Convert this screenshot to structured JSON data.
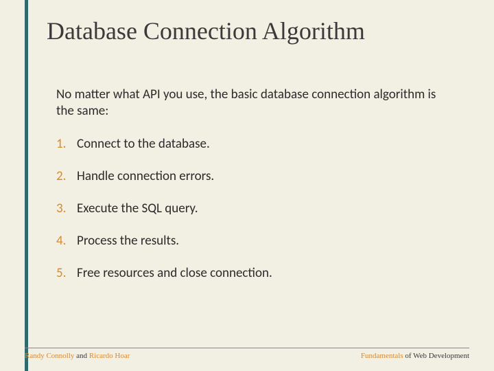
{
  "title": "Database Connection Algorithm",
  "intro": "No matter what API you use, the basic database connection algorithm is the same:",
  "steps": [
    {
      "num": "1.",
      "text": "Connect to the database."
    },
    {
      "num": "2.",
      "text": "Handle connection errors."
    },
    {
      "num": "3.",
      "text": "Execute the SQL query."
    },
    {
      "num": "4.",
      "text": "Process the results."
    },
    {
      "num": "5.",
      "text": "Free resources and close connection."
    }
  ],
  "footer": {
    "left_hl1": "Randy Connolly",
    "left_mid": " and ",
    "left_hl2": "Ricardo Hoar",
    "right_hl": "Fundamentals",
    "right_rest": " of Web Development"
  }
}
